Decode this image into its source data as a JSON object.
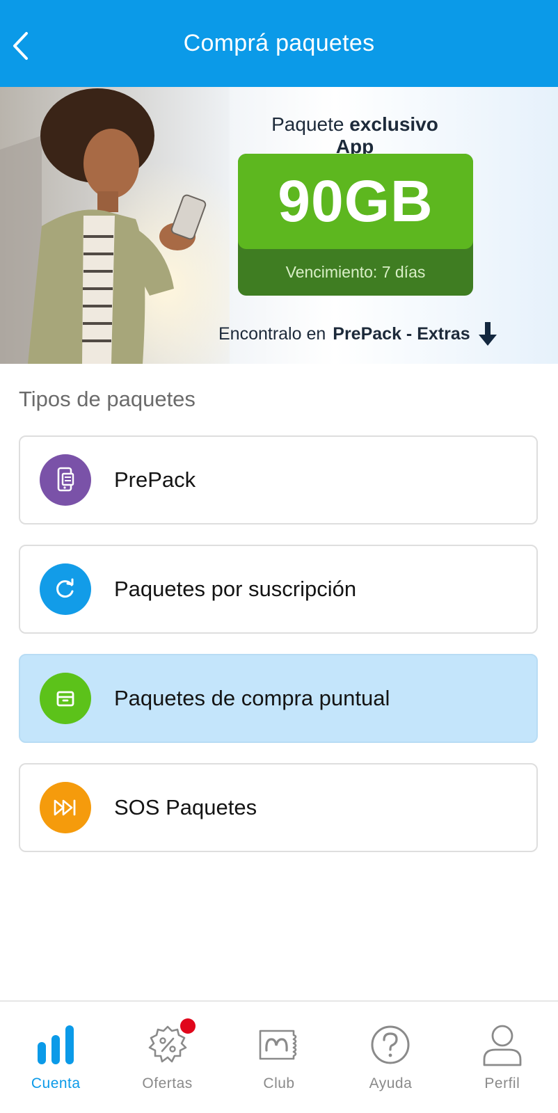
{
  "header": {
    "title": "Comprá paquetes"
  },
  "banner": {
    "heading_prefix": "Paquete",
    "heading_bold": "exclusivo App",
    "data_amount": "90GB",
    "expiry": "Vencimiento: 7 días",
    "footer_prefix": "Encontralo en",
    "footer_bold": "PrePack - Extras"
  },
  "section": {
    "title": "Tipos de paquetes",
    "items": [
      {
        "label": "PrePack",
        "icon": "phone-document-icon",
        "color": "#7a52a8"
      },
      {
        "label": "Paquetes por suscripción",
        "icon": "refresh-icon",
        "color": "#129ce8"
      },
      {
        "label": "Paquetes de compra puntual",
        "icon": "box-icon",
        "color": "#5cc21a"
      },
      {
        "label": "SOS Paquetes",
        "icon": "fast-forward-icon",
        "color": "#f59b0c"
      }
    ]
  },
  "nav": {
    "items": [
      {
        "label": "Cuenta",
        "icon": "bar-chart-icon"
      },
      {
        "label": "Ofertas",
        "icon": "discount-badge-icon"
      },
      {
        "label": "Club",
        "icon": "club-ticket-icon"
      },
      {
        "label": "Ayuda",
        "icon": "help-icon"
      },
      {
        "label": "Perfil",
        "icon": "profile-icon"
      }
    ]
  },
  "colors": {
    "header": "#0b9ae8",
    "selected_item": "#c4e5fb",
    "active_nav": "#0b9ae8",
    "notification": "#e0061b"
  }
}
